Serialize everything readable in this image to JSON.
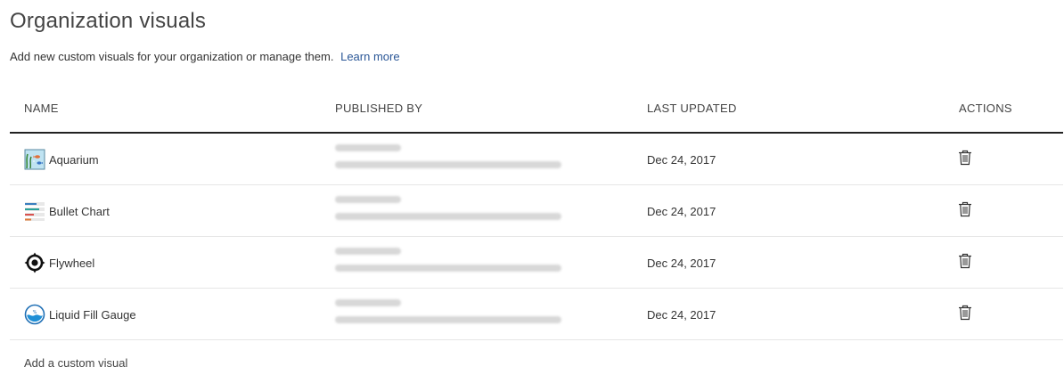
{
  "header": {
    "title": "Organization visuals",
    "description": "Add new custom visuals for your organization or manage them.",
    "learn_more": "Learn more"
  },
  "table": {
    "columns": {
      "name": "NAME",
      "published_by": "PUBLISHED BY",
      "last_updated": "LAST UPDATED",
      "actions": "ACTIONS"
    },
    "rows": [
      {
        "name": "Aquarium",
        "icon": "aquarium-icon",
        "last_updated": "Dec 24, 2017",
        "action_icon": "trash-icon"
      },
      {
        "name": "Bullet Chart",
        "icon": "bullet-chart-icon",
        "last_updated": "Dec 24, 2017",
        "action_icon": "trash-icon"
      },
      {
        "name": "Flywheel",
        "icon": "flywheel-icon",
        "last_updated": "Dec 24, 2017",
        "action_icon": "trash-icon"
      },
      {
        "name": "Liquid Fill Gauge",
        "icon": "liquid-fill-gauge-icon",
        "last_updated": "Dec 24, 2017",
        "action_icon": "trash-icon"
      }
    ]
  },
  "footer": {
    "add_label": "Add a custom visual"
  },
  "colors": {
    "link": "#2b5797",
    "header_rule": "#222222",
    "row_divider": "#e6e6e6"
  }
}
